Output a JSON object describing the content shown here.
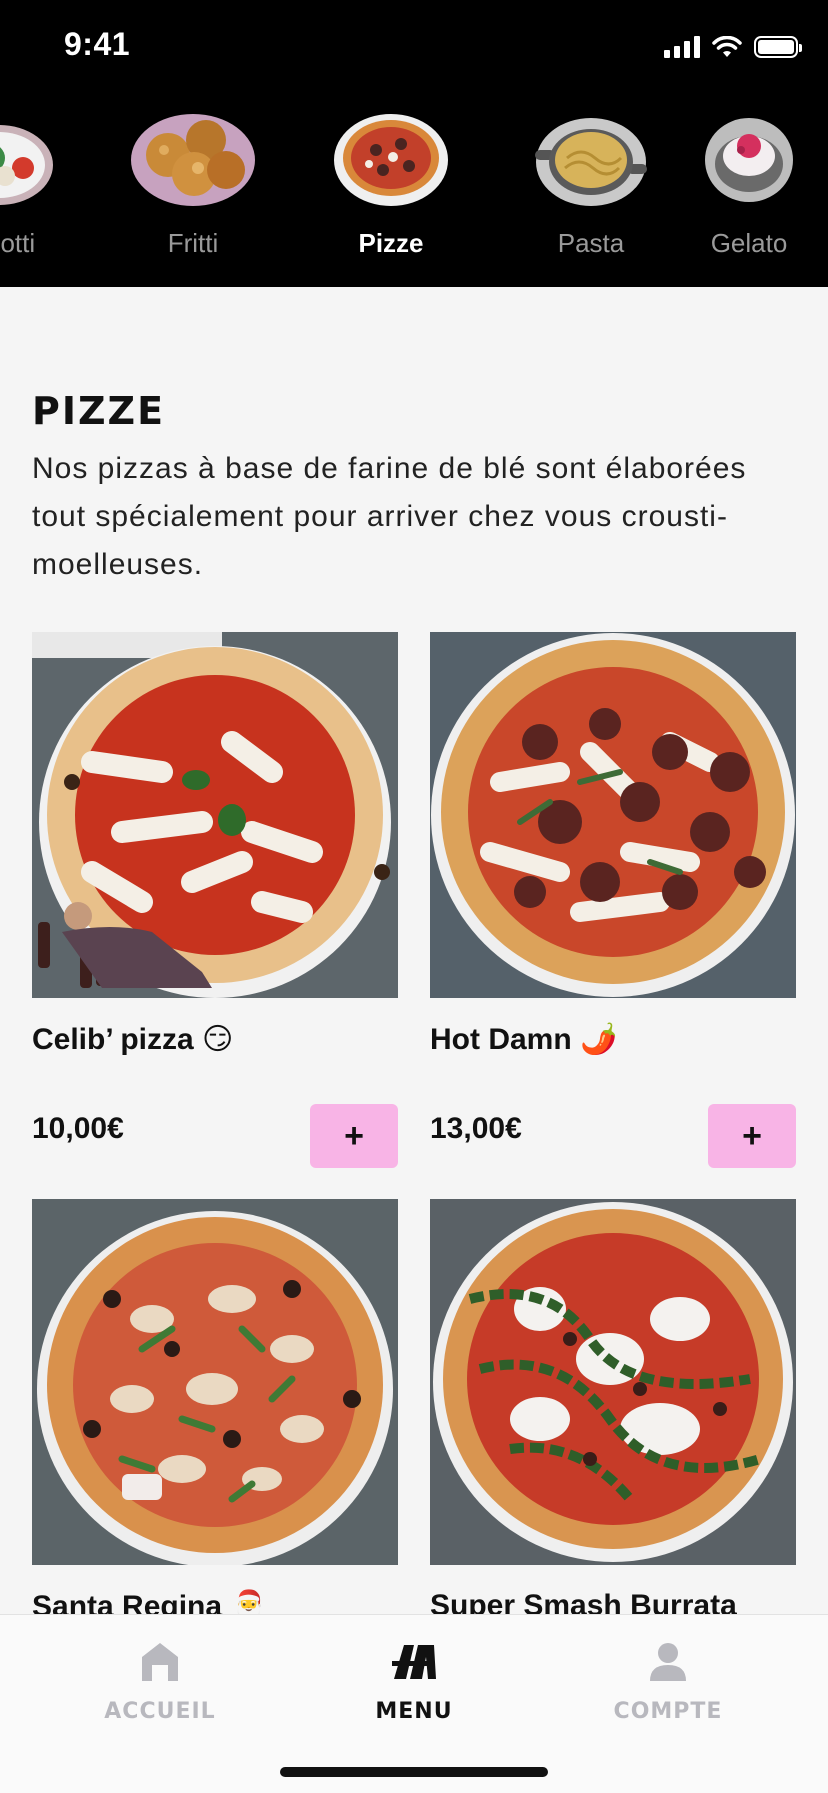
{
  "status_bar": {
    "time": "9:41"
  },
  "categories": [
    {
      "label": "rodotti",
      "icon": "antipasti-plate",
      "active": false
    },
    {
      "label": "Fritti",
      "icon": "fried-balls",
      "active": false
    },
    {
      "label": "Pizze",
      "icon": "pizza",
      "active": true
    },
    {
      "label": "Pasta",
      "icon": "pasta-pan",
      "active": false
    },
    {
      "label": "Gelato",
      "icon": "gelato-cup",
      "active": false
    }
  ],
  "section": {
    "title": "PIZZE",
    "description": "Nos pizzas à base de farine de blé sont élaborées tout spécialement pour arriver chez vous crousti-moelleuses."
  },
  "products": [
    {
      "name": "Celib’ pizza 😏",
      "price": "10,00€",
      "add_label": "+"
    },
    {
      "name": "Hot Damn 🌶️",
      "price": "13,00€",
      "add_label": "+"
    },
    {
      "name": "Santa Regina 🎅",
      "price": "",
      "add_label": "+"
    },
    {
      "name": "Super Smash Burrata",
      "price": "",
      "add_label": "+"
    }
  ],
  "tabbar": {
    "home": "ACCUEIL",
    "menu": "MENU",
    "account": "COMPTE",
    "active": "menu"
  },
  "colors": {
    "accent_pink": "#f8b4e6",
    "header_bg": "#000000",
    "inactive_tab": "#b8b8be"
  }
}
